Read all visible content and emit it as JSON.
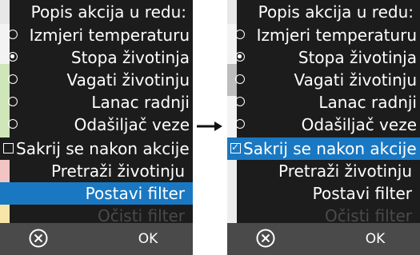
{
  "left_panel": {
    "title": "Popis akcija u redu:",
    "actions": [
      {
        "label": "Izmjeri temperaturu",
        "selected": false
      },
      {
        "label": "Stopa životinja",
        "selected": true
      },
      {
        "label": "Vagati životinju",
        "selected": false
      },
      {
        "label": "Lanac radnji",
        "selected": false
      },
      {
        "label": "Odašiljač veze",
        "selected": false
      }
    ],
    "hide_after_action": {
      "label": "Sakrij se nakon akcije",
      "checked": false
    },
    "buttons": {
      "search_animal": "Pretraži životinju",
      "set_filter": "Postavi filter",
      "clear_filter": "Očisti filter"
    },
    "footer": {
      "cancel_icon": "circle-x-icon",
      "ok_label": "OK"
    }
  },
  "right_panel": {
    "title": "Popis akcija u redu:",
    "actions": [
      {
        "label": "Izmjeri temperaturu",
        "selected": false
      },
      {
        "label": "Stopa životinja",
        "selected": true
      },
      {
        "label": "Vagati životinju",
        "selected": false
      },
      {
        "label": "Lanac radnji",
        "selected": false
      },
      {
        "label": "Odašiljač veze",
        "selected": false
      }
    ],
    "hide_after_action": {
      "label": "Sakrij se nakon akcije",
      "checked": true
    },
    "buttons": {
      "search_animal": "Pretraži životinju",
      "set_filter": "Postavi filter",
      "clear_filter": "Očisti filter"
    },
    "footer": {
      "cancel_icon": "circle-x-icon",
      "ok_label": "OK"
    }
  },
  "colors": {
    "panel_bg": "#1c1c1c",
    "highlight": "#1a78c2",
    "footer_bg": "#4a4a4a",
    "disabled_text": "#4a4a4a"
  }
}
